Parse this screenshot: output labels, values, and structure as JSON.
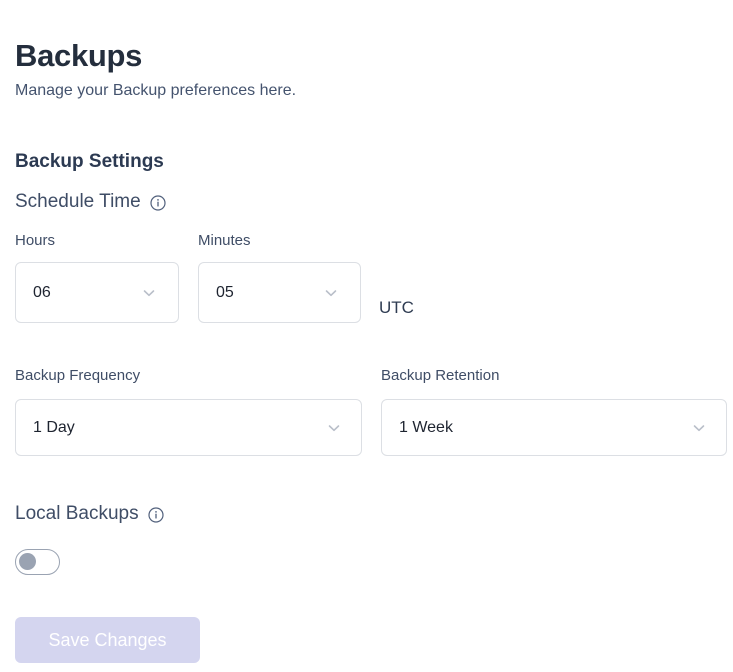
{
  "header": {
    "title": "Backups",
    "subtitle": "Manage your Backup preferences here."
  },
  "section": {
    "title": "Backup Settings"
  },
  "schedule": {
    "group_label": "Schedule Time",
    "info_icon": "info-circle-icon",
    "hours": {
      "label": "Hours",
      "value": "06",
      "chevron_icon": "chevron-down-icon"
    },
    "minutes": {
      "label": "Minutes",
      "value": "05",
      "chevron_icon": "chevron-down-icon"
    },
    "timezone": "UTC"
  },
  "frequency": {
    "label": "Backup Frequency",
    "value": "1 Day",
    "chevron_icon": "chevron-down-icon"
  },
  "retention": {
    "label": "Backup Retention",
    "value": "1 Week",
    "chevron_icon": "chevron-down-icon"
  },
  "local_backups": {
    "label": "Local Backups",
    "info_icon": "info-circle-icon",
    "toggle_state": "off"
  },
  "actions": {
    "save_label": "Save Changes",
    "save_disabled": true
  },
  "colors": {
    "title": "#242e3d",
    "subtitle": "#44536e",
    "label": "#3f4d66",
    "value": "#1e2430",
    "border": "#dcdfe4",
    "toggle_off": "#9aa3b2",
    "save_disabled_bg": "#d4d5ef",
    "save_text": "#ffffff"
  }
}
